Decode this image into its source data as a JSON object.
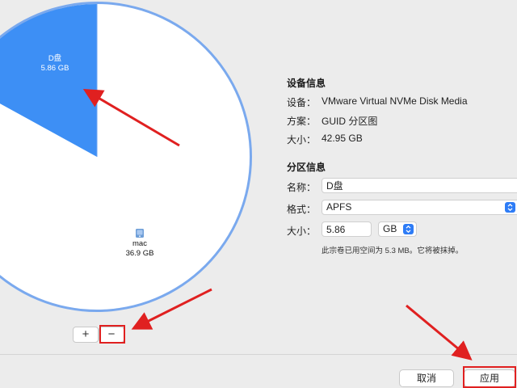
{
  "partitions": [
    {
      "name": "D盘",
      "size": "5.86 GB"
    },
    {
      "name": "mac",
      "size": "36.9 GB"
    }
  ],
  "device_info": {
    "title": "设备信息",
    "rows": [
      {
        "label": "设备：",
        "value": "VMware Virtual NVMe Disk Media"
      },
      {
        "label": "方案：",
        "value": "GUID 分区图"
      },
      {
        "label": "大小：",
        "value": "42.95 GB"
      }
    ]
  },
  "partition_info": {
    "title": "分区信息",
    "name_label": "名称：",
    "name_value": "D盘",
    "format_label": "格式：",
    "format_value": "APFS",
    "size_label": "大小：",
    "size_value": "5.86",
    "size_unit": "GB",
    "hint": "此宗卷已用空间为 5.3 MB。它将被抹掉。"
  },
  "controls": {
    "add": "+",
    "remove": "−"
  },
  "buttons": {
    "cancel": "取消",
    "apply": "应用"
  },
  "colors": {
    "accent": "#2e7cf6",
    "pie_ring": "#7aa9ee",
    "annotation": "#e02020"
  }
}
